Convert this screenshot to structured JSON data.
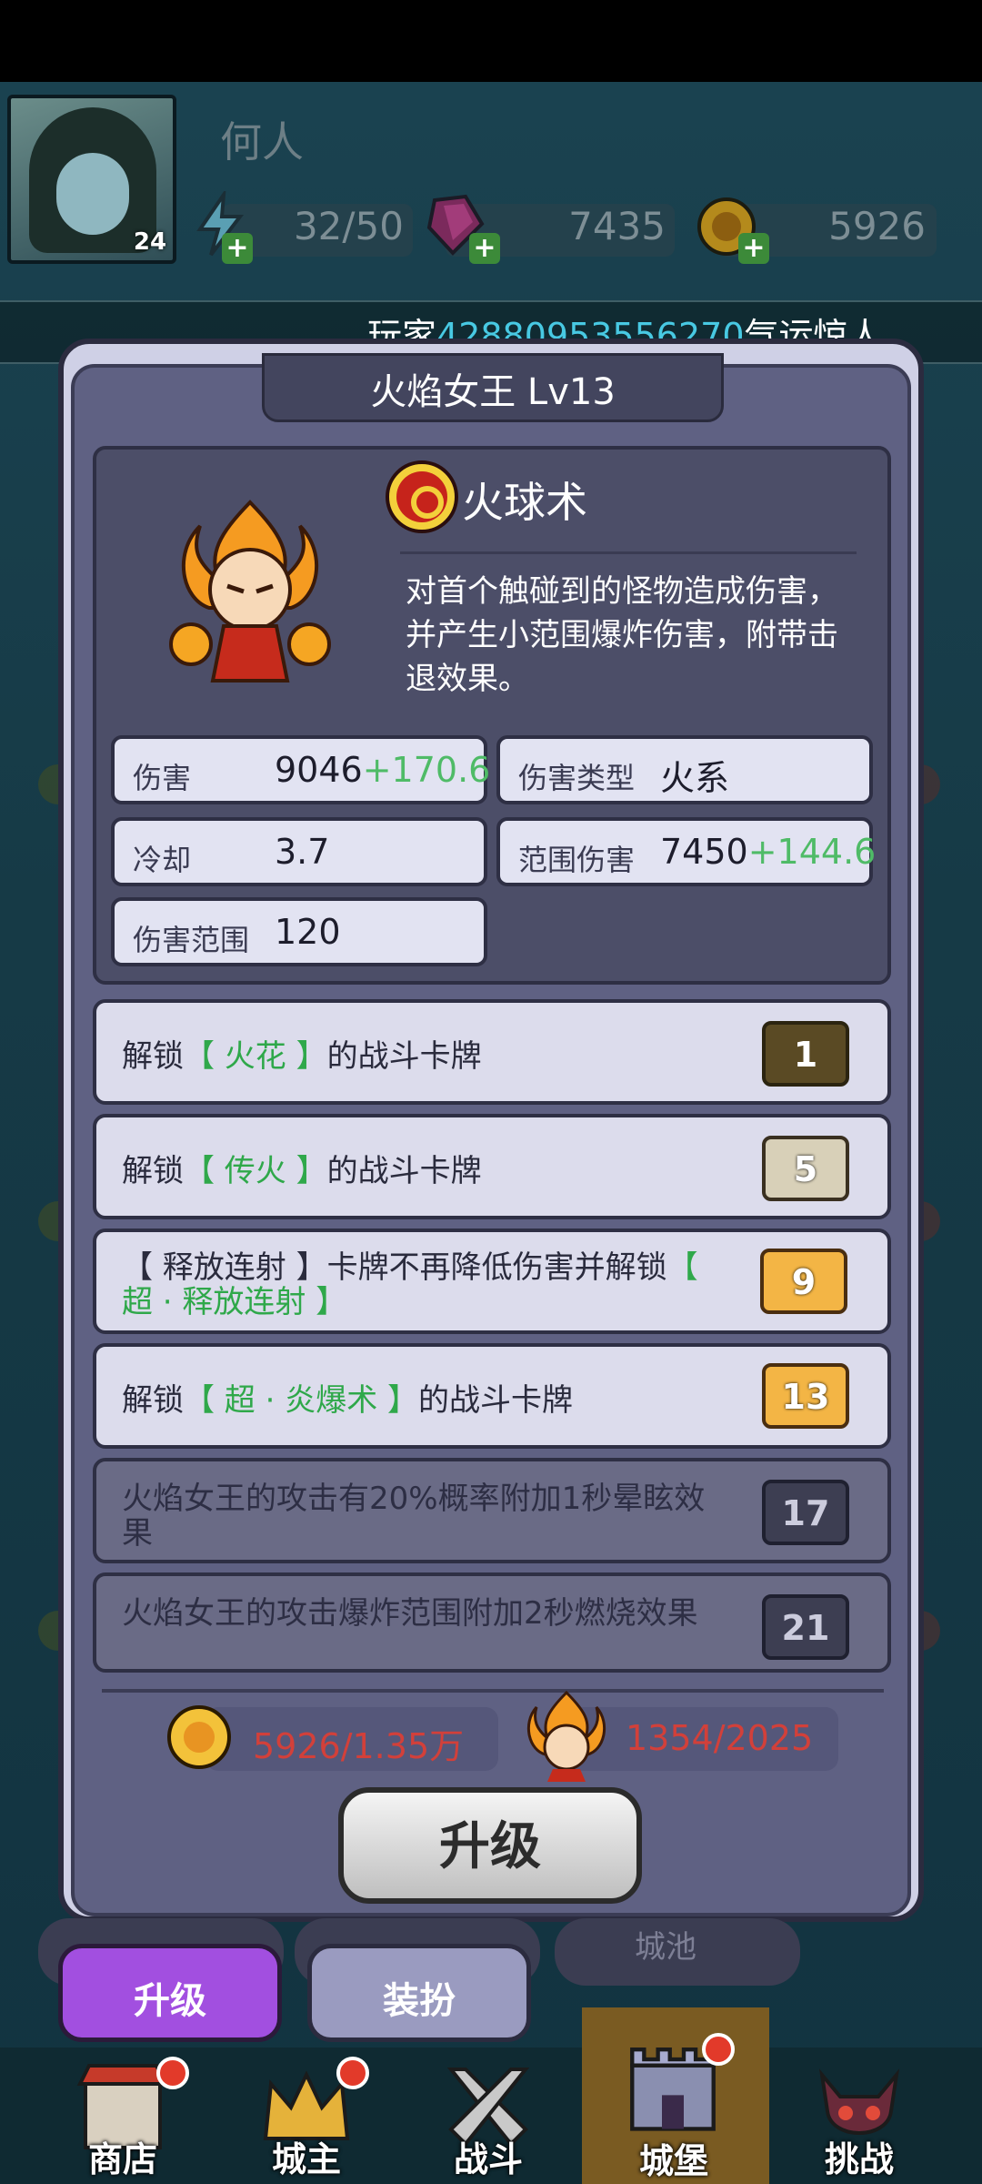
{
  "header": {
    "player_name": "何人",
    "avatar_level": "24",
    "energy": "32/50",
    "gems": "7435",
    "gold": "5926"
  },
  "ticker": {
    "prefix": "玩家",
    "highlight": "42880953556270",
    "suffix": "气运惊人，"
  },
  "modal": {
    "title": "火焰女王  Lv13",
    "skill": {
      "name": "火球术",
      "description": "对首个触碰到的怪物造成伤害，并产生小范围爆炸伤害，附带击退效果。"
    },
    "stats": {
      "damage_label": "伤害",
      "damage_value": "9046",
      "damage_bonus": "+170.6",
      "damage_type_label": "伤害类型",
      "damage_type_value": "火系",
      "cooldown_label": "冷却",
      "cooldown_value": "3.7",
      "aoe_label": "范围伤害",
      "aoe_value": "7450",
      "aoe_bonus": "+144.6",
      "range_label": "伤害范围",
      "range_value": "120"
    },
    "unlocks": [
      {
        "pre": "解锁",
        "hl": "【 火花 】",
        "post": "的战斗卡牌",
        "level": "1"
      },
      {
        "pre": "解锁",
        "hl": "【 传火 】",
        "post": "的战斗卡牌",
        "level": "5"
      },
      {
        "pre": "【 释放连射 】卡牌不再降低伤害并解锁",
        "hl": "【 超 · 释放连射 】",
        "post": "",
        "level": "9"
      },
      {
        "pre": "解锁",
        "hl": "【 超 · 炎爆术 】",
        "post": "的战斗卡牌",
        "level": "13"
      },
      {
        "pre": "火焰女王的攻击有20%概率附加1秒晕眩效果",
        "hl": "",
        "post": "",
        "level": "17"
      },
      {
        "pre": "火焰女王的攻击爆炸范围附加2秒燃烧效果",
        "hl": "",
        "post": "",
        "level": "21"
      }
    ],
    "cost_gold": "5926/1.35万",
    "cost_fragments": "1354/2025",
    "upgrade_button": "升级"
  },
  "tabs": {
    "upgrade": "升级",
    "outfit": "装扮",
    "behind_label": "城池"
  },
  "nav": [
    {
      "label": "商店",
      "icon": "shop-icon"
    },
    {
      "label": "城主",
      "icon": "crown-icon"
    },
    {
      "label": "战斗",
      "icon": "swords-icon"
    },
    {
      "label": "城堡",
      "icon": "castle-icon"
    },
    {
      "label": "挑战",
      "icon": "demon-icon"
    }
  ],
  "colors": {
    "bonus_green": "#4fbb67",
    "cost_red": "#d2403a",
    "tab_active": "#a24fe0",
    "ticker_highlight": "#48c9e3"
  }
}
